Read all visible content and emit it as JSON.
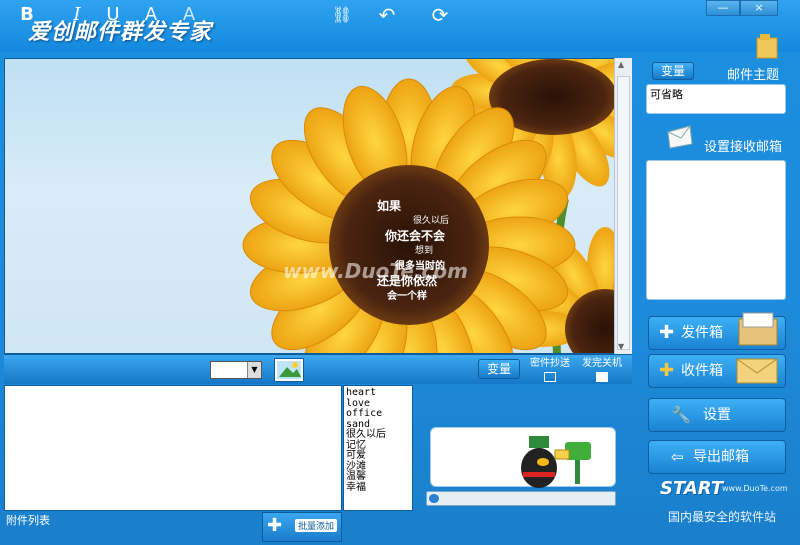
{
  "window": {
    "title": "爱创邮件群发专家",
    "minimize": "—",
    "close": "×"
  },
  "preview": {
    "overlay_lines": [
      "如果",
      "很久以后",
      "你还会不会",
      "想到",
      "很多当时的",
      "还是你依然",
      "会一个样"
    ],
    "watermark": "www.DuoTe.com"
  },
  "toolbar": {
    "variable_label": "变量",
    "cc_label": "密件抄送",
    "shutdown_label": "发完关机",
    "font_select_value": ""
  },
  "variables": [
    "heart",
    "love",
    "office",
    "sand",
    "很久以后",
    "记忆",
    "可爱",
    "沙滩",
    "温馨",
    "幸福"
  ],
  "attachments": {
    "label": "附件列表",
    "batch_add": "批量添加"
  },
  "right": {
    "variable_btn": "变量",
    "subject_title": "邮件主题",
    "subject_value": "可省略",
    "recipients_title": "设置接收邮箱",
    "outbox": "发件箱",
    "inbox": "收件箱",
    "settings": "设置",
    "export": "导出邮箱"
  },
  "footer": {
    "brand": "START",
    "slogan": "国内最安全的软件站",
    "site": "www.DuoTe.com"
  },
  "colors": {
    "accent": "#1d8ad9",
    "sunflower": "#f5b617",
    "center": "#3a1d0c"
  }
}
